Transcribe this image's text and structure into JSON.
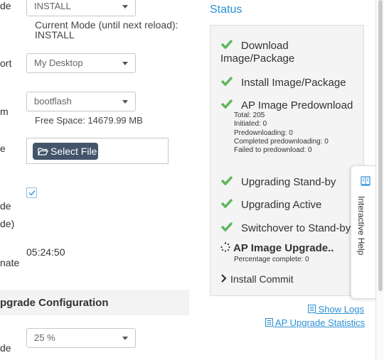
{
  "form": {
    "row1_label": "de",
    "install_mode": "INSTALL",
    "current_mode_line1": "Current Mode (until next reload):",
    "current_mode_line2": "INSTALL",
    "row2_label": "ort",
    "transport": "My Desktop",
    "row3_label": "m",
    "file_system": "bootflash",
    "free_space": "Free Space: 14679.99 MB",
    "row4_label": "e",
    "select_file_label": "Select File",
    "row5_label_a": "de",
    "row5_label_b": "de)",
    "checkbox_checked": true,
    "row6_label": "nate",
    "time_value": "05:24:50",
    "section_title": "pgrade Configuration",
    "row7_label": "de",
    "percentage": "25 %"
  },
  "status": {
    "title": "Status",
    "steps": [
      {
        "line1": "Download",
        "line2": "Image/Package",
        "state": "done"
      },
      {
        "line1": "Install Image/Package",
        "state": "done"
      },
      {
        "line1": "AP Image Predownload",
        "state": "done",
        "details": [
          "Total: 205",
          "Initiated: 0",
          "Predownloading: 0",
          "Completed predownloading: 0",
          "Failed to predownload: 0"
        ]
      },
      {
        "line1": "Upgrading Stand-by",
        "state": "done"
      },
      {
        "line1": "Upgrading Active",
        "state": "done"
      },
      {
        "line1": "Switchover to Stand-by",
        "state": "done"
      },
      {
        "line1": "AP Image Upgrade..",
        "state": "in-progress",
        "details": [
          "Percentage complete: 0"
        ]
      },
      {
        "line1": "Install Commit",
        "state": "pending"
      }
    ],
    "show_logs": "Show Logs",
    "ap_upgrade_statistics": "AP Upgrade Statistics"
  },
  "help": {
    "label": "Interactive Help",
    "icon": "book-icon"
  },
  "colors": {
    "accent": "#2b8fd4",
    "success": "#5cb85c",
    "button_dark": "#44546a"
  }
}
